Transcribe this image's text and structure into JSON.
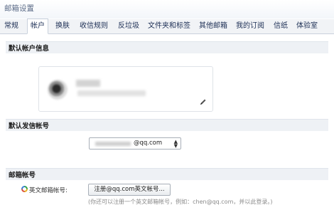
{
  "window": {
    "title": "邮箱设置"
  },
  "tabs": [
    {
      "label": "常规"
    },
    {
      "label": "帐户"
    },
    {
      "label": "换肤"
    },
    {
      "label": "收信规则"
    },
    {
      "label": "反垃圾"
    },
    {
      "label": "文件夹和标签"
    },
    {
      "label": "其他邮箱"
    },
    {
      "label": "我的订阅"
    },
    {
      "label": "信纸"
    },
    {
      "label": "体验室"
    }
  ],
  "active_tab": "帐户",
  "sections": {
    "default_account": {
      "title": "默认帐户信息"
    },
    "default_sender": {
      "title": "默认发信帐号",
      "selected_value": "@qq.com"
    },
    "mailbox_account": {
      "title": "邮箱帐号",
      "english_label": "英文邮箱帐号:",
      "register_button": "注册@qq.com英文帐号...",
      "hint": "(你还可以注册一个英文邮箱帐号，例如：chen@qq.com，并以此登录。)"
    }
  },
  "icons": {
    "edit": "pencil-icon",
    "dropdown": "updown-arrow-icon",
    "mailbox": "qq-color-icon"
  },
  "colors": {
    "title_text": "#5b6b87",
    "tab_text": "#1d2f55",
    "section_band": "#eef1f5"
  }
}
